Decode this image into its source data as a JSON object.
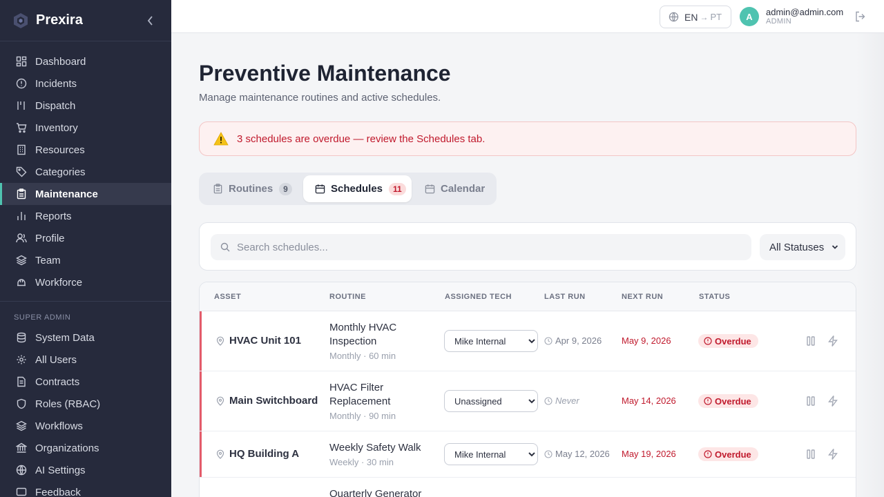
{
  "app": {
    "name": "Prexira"
  },
  "sidebar": {
    "items": [
      {
        "label": "Dashboard"
      },
      {
        "label": "Incidents"
      },
      {
        "label": "Dispatch"
      },
      {
        "label": "Inventory"
      },
      {
        "label": "Resources"
      },
      {
        "label": "Categories"
      },
      {
        "label": "Maintenance"
      },
      {
        "label": "Reports"
      },
      {
        "label": "Profile"
      },
      {
        "label": "Team"
      },
      {
        "label": "Workforce"
      }
    ],
    "admin_section": "SUPER ADMIN",
    "admin_items": [
      {
        "label": "System Data"
      },
      {
        "label": "All Users"
      },
      {
        "label": "Contracts"
      },
      {
        "label": "Roles (RBAC)"
      },
      {
        "label": "Workflows"
      },
      {
        "label": "Organizations"
      },
      {
        "label": "AI Settings"
      },
      {
        "label": "Feedback"
      }
    ]
  },
  "header": {
    "lang_current": "EN",
    "lang_arrow": "→",
    "lang_alt": "PT",
    "avatar_letter": "A",
    "user_email": "admin@admin.com",
    "user_role": "ADMIN"
  },
  "page": {
    "title": "Preventive Maintenance",
    "subtitle": "Manage maintenance routines and active schedules.",
    "alert": "3 schedules are overdue — review the Schedules tab."
  },
  "tabs": [
    {
      "label": "Routines",
      "count": "9"
    },
    {
      "label": "Schedules",
      "count": "11"
    },
    {
      "label": "Calendar"
    }
  ],
  "filters": {
    "search_placeholder": "Search schedules...",
    "status": "All Statuses"
  },
  "table": {
    "headers": [
      "ASSET",
      "ROUTINE",
      "ASSIGNED TECH",
      "LAST RUN",
      "NEXT RUN",
      "STATUS"
    ],
    "rows": [
      {
        "asset": "HVAC Unit 101",
        "routine": "Monthly HVAC Inspection",
        "meta": "Monthly · 60 min",
        "tech": "Mike Internal",
        "last_run": "Apr 9, 2026",
        "next_run": "May 9, 2026",
        "status": "Overdue"
      },
      {
        "asset": "Main Switchboard",
        "routine": "HVAC Filter Replacement",
        "meta": "Monthly · 90 min",
        "tech": "Unassigned",
        "last_run": "Never",
        "next_run": "May 14, 2026",
        "status": "Overdue"
      },
      {
        "asset": "HQ Building A",
        "routine": "Weekly Safety Walk",
        "meta": "Weekly · 30 min",
        "tech": "Mike Internal",
        "last_run": "May 12, 2026",
        "next_run": "May 19, 2026",
        "status": "Overdue"
      },
      {
        "routine": "Quarterly Generator"
      }
    ]
  },
  "colors": {
    "sidebar_bg": "#262a3c",
    "accent": "#4fc3b0",
    "danger": "#c0192c"
  }
}
